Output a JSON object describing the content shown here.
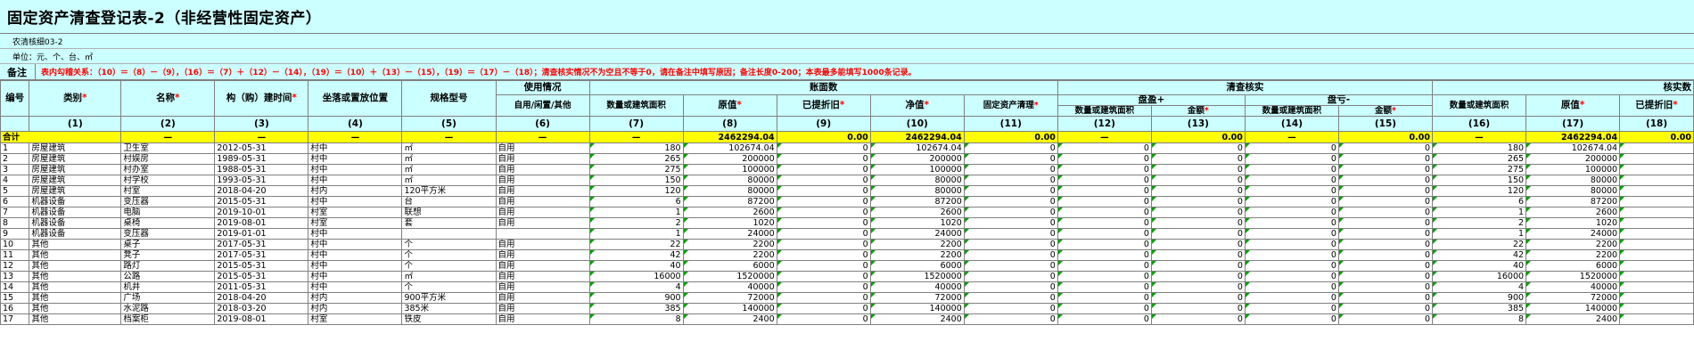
{
  "title": "固定资产清查登记表-2（非经营性固定资产）",
  "form_code": "农清核细03-2",
  "unit": "单位：元、个、台、㎡",
  "note_label": "备注",
  "note_text": "表内勾稽关系：（10）＝（8）－（9），（16）＝（7）＋（12）－（14），（19）＝（10）＋（13）－（15），（19）＝（17）－（18）；清查核实情况不为空且不等于0，请在备注中填写原因；备注长度0-200；本表最多能填写1000条记录。",
  "headers": {
    "no": "编号",
    "category": "类别",
    "name": "名称",
    "build_time": "构（购）建时间",
    "location": "坐落或置放位置",
    "spec": "规格型号",
    "usage_group": "使用情况",
    "usage": "自用/闲置/其他",
    "book_group": "账面数",
    "area": "数量或建筑面积",
    "original": "原值",
    "dep": "已提折旧",
    "net": "净值",
    "clean": "固定资产清理",
    "check_group": "清查核实",
    "surplus_group": "盘盈+",
    "surplus_area": "数量或建筑面积",
    "surplus_amount": "金额",
    "loss_group": "盘亏-",
    "loss_area": "数量或建筑面积",
    "loss_amount": "金额",
    "verify_group": "核实数",
    "v_area": "数量或建筑面积",
    "v_original": "原值",
    "v_dep": "已提折旧",
    "req": "*"
  },
  "col_numbers": [
    "(1)",
    "(2)",
    "(3)",
    "(4)",
    "(5)",
    "(6)",
    "(7)",
    "(8)",
    "(9)",
    "(10)",
    "(11)",
    "(12)",
    "(13)",
    "(14)",
    "(15)",
    "(16)",
    "(17)",
    "(18)"
  ],
  "total": {
    "label": "合计",
    "dash": "—",
    "original": "2462294.04",
    "dep": "0.00",
    "net": "2462294.04",
    "clean": "0.00",
    "surplus_amount": "0.00",
    "loss_amount": "0.00",
    "v_original": "2462294.04",
    "v_dep": "0.00"
  },
  "rows": [
    {
      "no": "1",
      "cat": "房屋建筑",
      "name": "卫生室",
      "time": "2012-05-31",
      "loc": "村中",
      "spec": "㎡",
      "use": "自用",
      "area": "180",
      "orig": "102674.04",
      "dep": "0",
      "net": "102674.04",
      "clean": "0",
      "sa": "0",
      "sm": "0",
      "la": "0",
      "lm": "0",
      "va": "180",
      "vo": "102674.04"
    },
    {
      "no": "2",
      "cat": "房屋建筑",
      "name": "村娱房",
      "time": "1989-05-31",
      "loc": "村中",
      "spec": "㎡",
      "use": "自用",
      "area": "265",
      "orig": "200000",
      "dep": "0",
      "net": "200000",
      "clean": "0",
      "sa": "0",
      "sm": "0",
      "la": "0",
      "lm": "0",
      "va": "265",
      "vo": "200000"
    },
    {
      "no": "3",
      "cat": "房屋建筑",
      "name": "村办室",
      "time": "1988-05-31",
      "loc": "村中",
      "spec": "㎡",
      "use": "自用",
      "area": "275",
      "orig": "100000",
      "dep": "0",
      "net": "100000",
      "clean": "0",
      "sa": "0",
      "sm": "0",
      "la": "0",
      "lm": "0",
      "va": "275",
      "vo": "100000"
    },
    {
      "no": "4",
      "cat": "房屋建筑",
      "name": "村学校",
      "time": "1993-05-31",
      "loc": "村中",
      "spec": "㎡",
      "use": "自用",
      "area": "150",
      "orig": "80000",
      "dep": "0",
      "net": "80000",
      "clean": "0",
      "sa": "0",
      "sm": "0",
      "la": "0",
      "lm": "0",
      "va": "150",
      "vo": "80000"
    },
    {
      "no": "5",
      "cat": "房屋建筑",
      "name": "村室",
      "time": "2018-04-20",
      "loc": "村内",
      "spec": "120平方米",
      "use": "自用",
      "area": "120",
      "orig": "80000",
      "dep": "0",
      "net": "80000",
      "clean": "0",
      "sa": "0",
      "sm": "0",
      "la": "0",
      "lm": "0",
      "va": "120",
      "vo": "80000"
    },
    {
      "no": "6",
      "cat": "机器设备",
      "name": "变压器",
      "time": "2015-05-31",
      "loc": "村中",
      "spec": "台",
      "use": "自用",
      "area": "6",
      "orig": "87200",
      "dep": "0",
      "net": "87200",
      "clean": "0",
      "sa": "0",
      "sm": "0",
      "la": "0",
      "lm": "0",
      "va": "6",
      "vo": "87200"
    },
    {
      "no": "7",
      "cat": "机器设备",
      "name": "电脑",
      "time": "2019-10-01",
      "loc": "村室",
      "spec": "联想",
      "use": "自用",
      "area": "1",
      "orig": "2600",
      "dep": "0",
      "net": "2600",
      "clean": "0",
      "sa": "0",
      "sm": "0",
      "la": "0",
      "lm": "0",
      "va": "1",
      "vo": "2600"
    },
    {
      "no": "8",
      "cat": "机器设备",
      "name": "桌椅",
      "time": "2019-08-01",
      "loc": "村室",
      "spec": "套",
      "use": "自用",
      "area": "2",
      "orig": "1020",
      "dep": "0",
      "net": "1020",
      "clean": "0",
      "sa": "0",
      "sm": "0",
      "la": "0",
      "lm": "0",
      "va": "2",
      "vo": "1020"
    },
    {
      "no": "9",
      "cat": "机器设备",
      "name": "变压器",
      "time": "2019-01-01",
      "loc": "村中",
      "spec": "",
      "use": "",
      "area": "1",
      "orig": "24000",
      "dep": "0",
      "net": "24000",
      "clean": "0",
      "sa": "0",
      "sm": "0",
      "la": "0",
      "lm": "0",
      "va": "1",
      "vo": "24000"
    },
    {
      "no": "10",
      "cat": "其他",
      "name": "桌子",
      "time": "2017-05-31",
      "loc": "村中",
      "spec": "个",
      "use": "自用",
      "area": "22",
      "orig": "2200",
      "dep": "0",
      "net": "2200",
      "clean": "0",
      "sa": "0",
      "sm": "0",
      "la": "0",
      "lm": "0",
      "va": "22",
      "vo": "2200"
    },
    {
      "no": "11",
      "cat": "其他",
      "name": "凳子",
      "time": "2017-05-31",
      "loc": "村中",
      "spec": "个",
      "use": "自用",
      "area": "42",
      "orig": "2200",
      "dep": "0",
      "net": "2200",
      "clean": "0",
      "sa": "0",
      "sm": "0",
      "la": "0",
      "lm": "0",
      "va": "42",
      "vo": "2200"
    },
    {
      "no": "12",
      "cat": "其他",
      "name": "路灯",
      "time": "2015-05-31",
      "loc": "村中",
      "spec": "个",
      "use": "自用",
      "area": "40",
      "orig": "6000",
      "dep": "0",
      "net": "6000",
      "clean": "0",
      "sa": "0",
      "sm": "0",
      "la": "0",
      "lm": "0",
      "va": "40",
      "vo": "6000"
    },
    {
      "no": "13",
      "cat": "其他",
      "name": "公路",
      "time": "2015-05-31",
      "loc": "村中",
      "spec": "㎡",
      "use": "自用",
      "area": "16000",
      "orig": "1520000",
      "dep": "0",
      "net": "1520000",
      "clean": "0",
      "sa": "0",
      "sm": "0",
      "la": "0",
      "lm": "0",
      "va": "16000",
      "vo": "1520000"
    },
    {
      "no": "14",
      "cat": "其他",
      "name": "机井",
      "time": "2011-05-31",
      "loc": "村中",
      "spec": "个",
      "use": "自用",
      "area": "4",
      "orig": "40000",
      "dep": "0",
      "net": "40000",
      "clean": "0",
      "sa": "0",
      "sm": "0",
      "la": "0",
      "lm": "0",
      "va": "4",
      "vo": "40000"
    },
    {
      "no": "15",
      "cat": "其他",
      "name": "广场",
      "time": "2018-04-20",
      "loc": "村内",
      "spec": "900平方米",
      "use": "自用",
      "area": "900",
      "orig": "72000",
      "dep": "0",
      "net": "72000",
      "clean": "0",
      "sa": "0",
      "sm": "0",
      "la": "0",
      "lm": "0",
      "va": "900",
      "vo": "72000"
    },
    {
      "no": "16",
      "cat": "其他",
      "name": "水泥路",
      "time": "2018-03-20",
      "loc": "村内",
      "spec": "385米",
      "use": "自用",
      "area": "385",
      "orig": "140000",
      "dep": "0",
      "net": "140000",
      "clean": "0",
      "sa": "0",
      "sm": "0",
      "la": "0",
      "lm": "0",
      "va": "385",
      "vo": "140000"
    },
    {
      "no": "17",
      "cat": "其他",
      "name": "档案柜",
      "time": "2019-08-01",
      "loc": "村室",
      "spec": "铁皮",
      "use": "自用",
      "area": "8",
      "orig": "2400",
      "dep": "0",
      "net": "2400",
      "clean": "0",
      "sa": "0",
      "sm": "0",
      "la": "0",
      "lm": "0",
      "va": "8",
      "vo": "2400"
    }
  ]
}
